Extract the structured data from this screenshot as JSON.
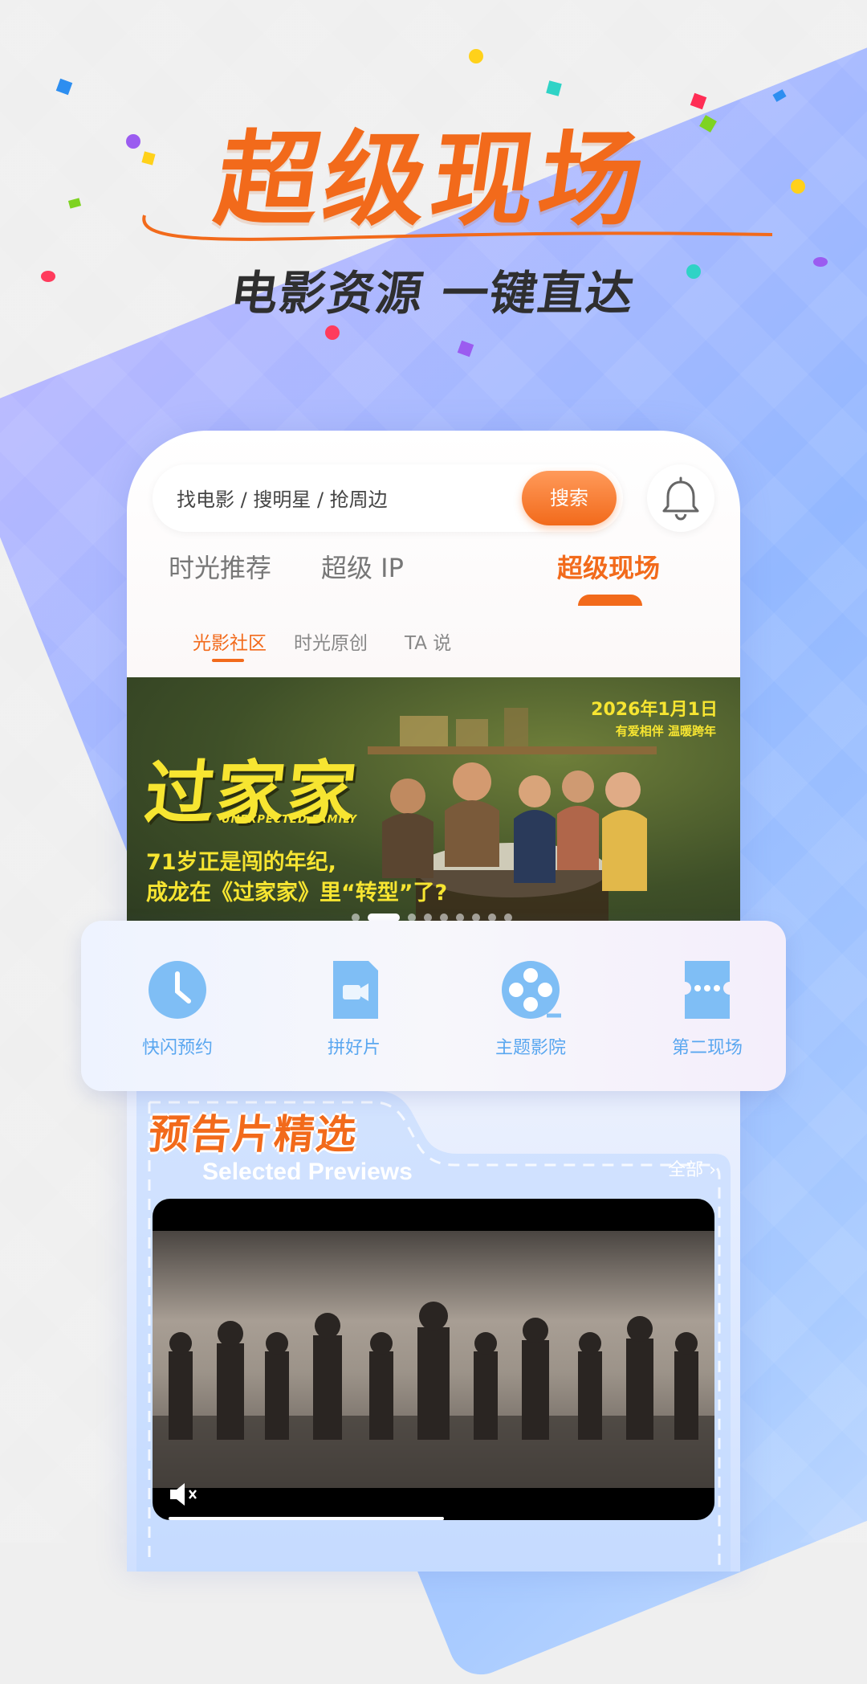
{
  "promo": {
    "headline": "超级现场",
    "subline": "电影资源 一键直达"
  },
  "search": {
    "placeholder": "找电影 / 搜明星 / 抢周边",
    "button_label": "搜索"
  },
  "tabs": [
    {
      "label": "时光推荐"
    },
    {
      "label": "超级 IP"
    },
    {
      "label": "超级现场"
    }
  ],
  "active_tab": "超级现场",
  "subtabs": [
    {
      "label": "光影社区"
    },
    {
      "label": "时光原创"
    },
    {
      "label": "TA 说"
    }
  ],
  "active_subtab": "光影社区",
  "banner": {
    "title": "过家家",
    "title_en": "UNEXPECTED FAMILY",
    "headline_line1": "71岁正是闯的年纪,",
    "headline_line2": "成龙在《过家家》里“转型”了?",
    "date": "2026年1月1日",
    "tagline": "有爱相伴 温暖跨年",
    "slide_count": 9,
    "active_slide": 2
  },
  "quick_actions": [
    {
      "label": "快闪预约",
      "icon": "clock-icon"
    },
    {
      "label": "拼好片",
      "icon": "film-card-icon"
    },
    {
      "label": "主题影院",
      "icon": "film-reel-icon"
    },
    {
      "label": "第二现场",
      "icon": "ticket-icon"
    }
  ],
  "previews": {
    "title": "预告片精选",
    "subtitle": "Selected Previews",
    "all_label": "全部",
    "video_progress": 0.49
  },
  "colors": {
    "accent": "#f26a1b",
    "quick_icon": "#7fbef5",
    "banner_text": "#f7e531"
  }
}
